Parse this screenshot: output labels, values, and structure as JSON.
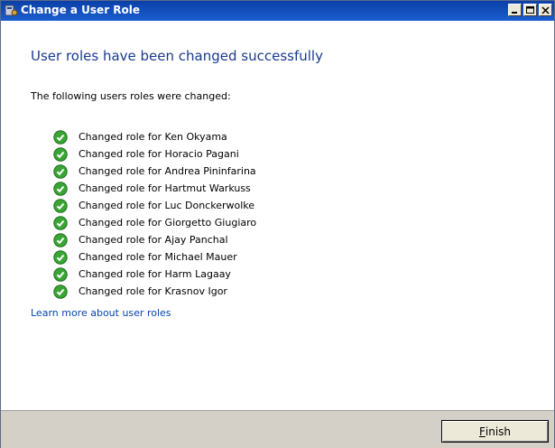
{
  "window": {
    "title": "Change a User Role"
  },
  "main": {
    "heading": "User roles have been changed successfully",
    "subtext": "The following users roles were changed:",
    "items": [
      "Changed role for Ken Okyama",
      "Changed role for Horacio Pagani",
      "Changed role for Andrea Pininfarina",
      "Changed role for Hartmut Warkuss",
      "Changed role for Luc Donckerwolke",
      "Changed role for Giorgetto Giugiaro",
      "Changed role for Ajay Panchal",
      "Changed role for Michael Mauer",
      "Changed role for Harm Lagaay",
      "Changed role for Krasnov Igor"
    ],
    "learn_link": "Learn more about user roles"
  },
  "footer": {
    "finish_first": "F",
    "finish_rest": "inish"
  },
  "colors": {
    "heading": "#1a3a8c",
    "link": "#0645ad",
    "check": "#3aa535",
    "footer_bg": "#d4d0c8"
  },
  "icons": {
    "app": "server-app-icon",
    "status": "check-icon"
  }
}
